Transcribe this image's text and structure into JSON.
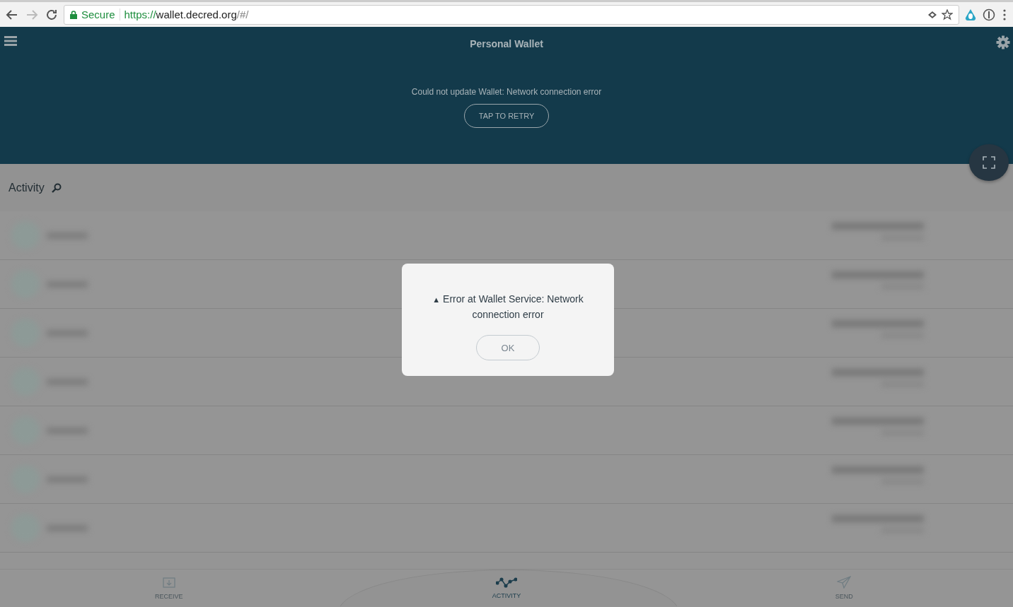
{
  "browser": {
    "security_label": "Secure",
    "url": {
      "scheme": "https://",
      "host": "wallet.decred.org",
      "path": "/#/"
    }
  },
  "header": {
    "title": "Personal Wallet",
    "error_message": "Could not update Wallet: Network connection error",
    "retry_button": "TAP TO RETRY"
  },
  "activity": {
    "title": "Activity"
  },
  "dialog": {
    "icon": "▲",
    "message": "Error at Wallet Service: Network connection error",
    "button": "OK"
  },
  "bottom_nav": [
    {
      "label": "RECEIVE",
      "kind": "receive",
      "selected": false
    },
    {
      "label": "ACTIVITY",
      "kind": "activity",
      "selected": true
    },
    {
      "label": "SEND",
      "kind": "send",
      "selected": false
    }
  ]
}
